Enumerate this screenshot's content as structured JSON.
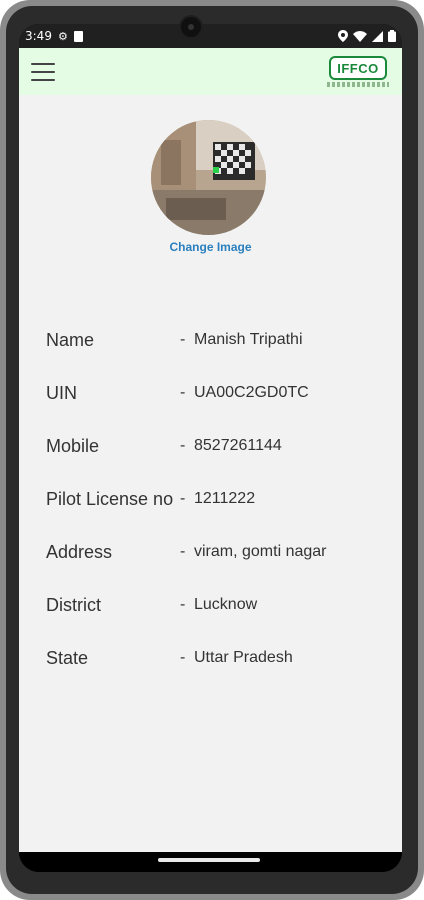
{
  "status_bar": {
    "time": "3:49",
    "icons": [
      "settings-icon",
      "sd-card-icon",
      "location-icon",
      "wifi-icon",
      "signal-icon",
      "battery-icon"
    ]
  },
  "header": {
    "menu_icon": "hamburger-menu-icon",
    "logo_text": "IFFCO",
    "brand_color": "#1a8a3a",
    "header_bg": "#e4fbe4"
  },
  "profile": {
    "change_image_label": "Change Image",
    "link_color": "#2a7fbf",
    "fields": [
      {
        "label": "Name",
        "separator": "-",
        "value": "Manish Tripathi"
      },
      {
        "label": "UIN",
        "separator": "-",
        "value": "UA00C2GD0TC"
      },
      {
        "label": "Mobile",
        "separator": "-",
        "value": "8527261144"
      },
      {
        "label": "Pilot License no",
        "separator": "-",
        "value": "1211222"
      },
      {
        "label": "Address",
        "separator": "-",
        "value": "viram, gomti nagar"
      },
      {
        "label": "District",
        "separator": "-",
        "value": "Lucknow"
      },
      {
        "label": "State",
        "separator": "-",
        "value": "Uttar Pradesh"
      }
    ]
  }
}
